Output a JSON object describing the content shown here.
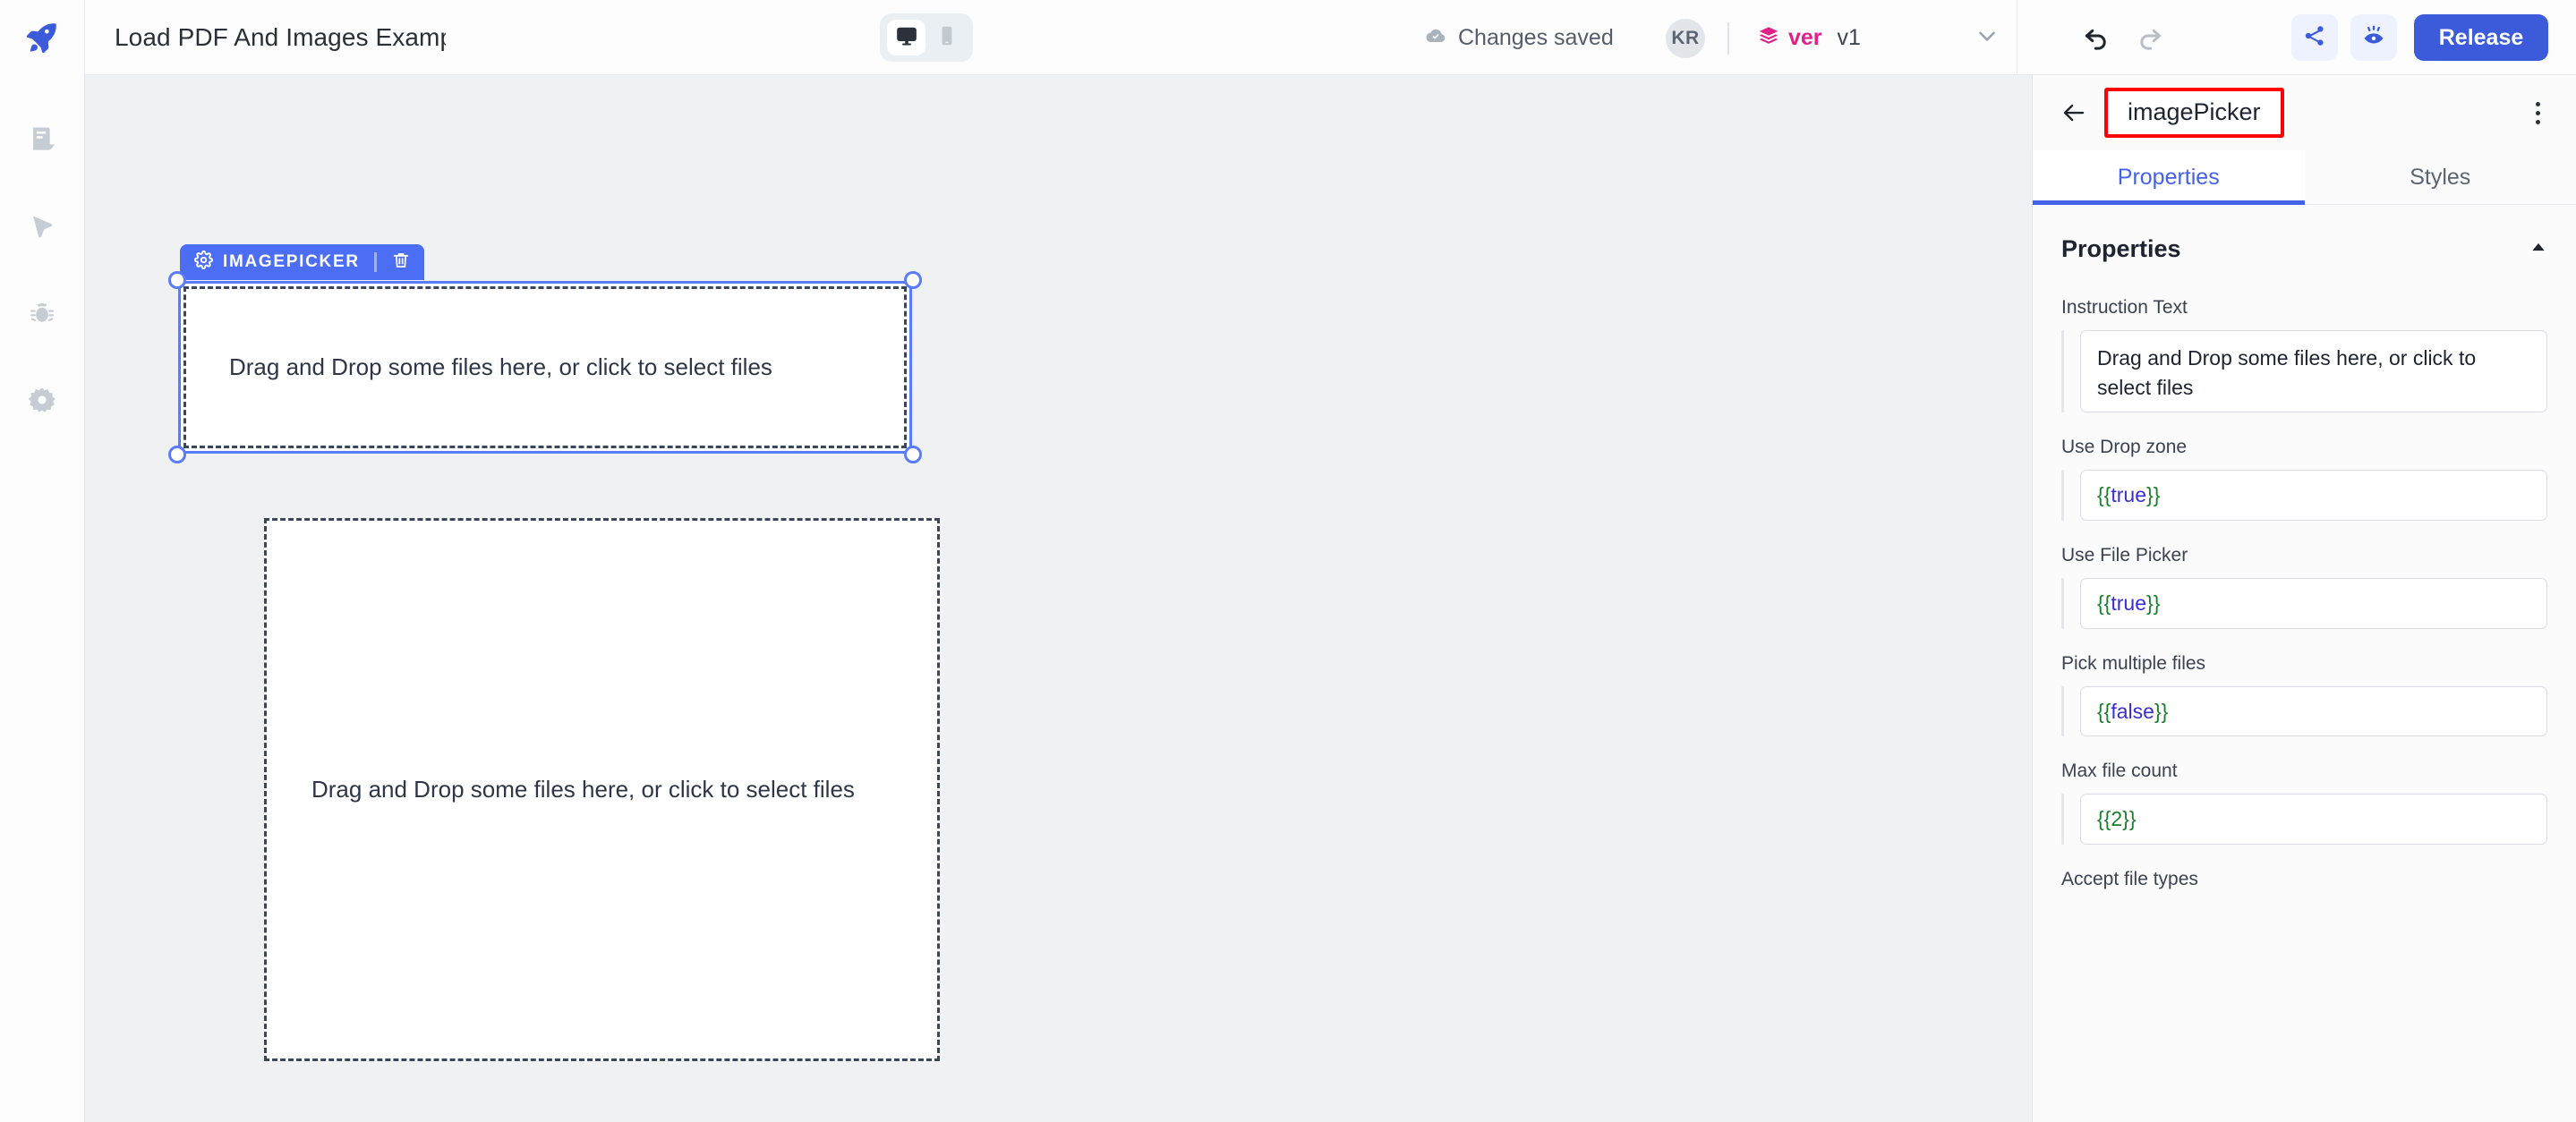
{
  "header": {
    "logo_icon": "rocket-icon",
    "app_title": "Load PDF And Images Examp",
    "device_toggle": {
      "desktop_icon": "desktop-monitor-icon",
      "mobile_icon": "mobile-phone-icon",
      "selected": "desktop"
    },
    "save_status_icon": "cloud-check-icon",
    "save_status": "Changes saved",
    "avatar_initials": "KR",
    "version_icon": "layers-icon",
    "version_label": "ver",
    "version_number": "v1",
    "version_chevron_icon": "chevron-down-icon",
    "undo_icon": "undo-arrow-icon",
    "redo_icon": "redo-arrow-icon",
    "share_icon": "share-nodes-icon",
    "preview_icon": "eye-preview-icon",
    "release_label": "Release"
  },
  "left_sidebar": {
    "items": [
      {
        "icon": "pages-document-icon",
        "name": "pages"
      },
      {
        "icon": "cursor-pointer-icon",
        "name": "widgets"
      },
      {
        "icon": "bug-debug-icon",
        "name": "debugger"
      },
      {
        "icon": "gear-settings-icon",
        "name": "settings"
      }
    ]
  },
  "canvas": {
    "selected_widget": {
      "badge_icon": "gear-settings-icon",
      "badge_label": "IMAGEPICKER",
      "delete_icon": "trash-delete-icon",
      "dropzone_text": "Drag and Drop some files here, or click to select files"
    },
    "second_widget": {
      "dropzone_text": "Drag and Drop some files here, or click to select files"
    }
  },
  "right_panel": {
    "back_icon": "back-arrow-icon",
    "widget_name": "imagePicker",
    "kebab_icon": "more-options-icon",
    "tabs": [
      {
        "label": "Properties",
        "active": true
      },
      {
        "label": "Styles",
        "active": false
      }
    ],
    "section": {
      "title": "Properties",
      "collapse_icon": "caret-up-icon"
    },
    "properties": [
      {
        "label": "Instruction Text",
        "value": "Drag and Drop some files here, or click to select files",
        "kind": "text"
      },
      {
        "label": "Use Drop zone",
        "open": "{{",
        "value": "true",
        "close": "}}",
        "kind": "code"
      },
      {
        "label": "Use File Picker",
        "open": "{{",
        "value": "true",
        "close": "}}",
        "kind": "code"
      },
      {
        "label": "Pick multiple files",
        "open": "{{",
        "value": "false",
        "close": "}}",
        "kind": "code"
      },
      {
        "label": "Max file count",
        "open": "{{",
        "value": "2",
        "close": "}}",
        "kind": "code-number"
      },
      {
        "label": "Accept file types",
        "value": "",
        "kind": "partial"
      }
    ]
  },
  "colors": {
    "brand_blue": "#3b5bdb",
    "selection_blue": "#5b7cfa",
    "badge_blue": "#4c6ef5",
    "accent_pink": "#e0218a",
    "annotation_red": "#ff0000",
    "code_green": "#1b7f2e",
    "code_blue": "#3a2fd0",
    "canvas_bg": "#eff1f3"
  }
}
